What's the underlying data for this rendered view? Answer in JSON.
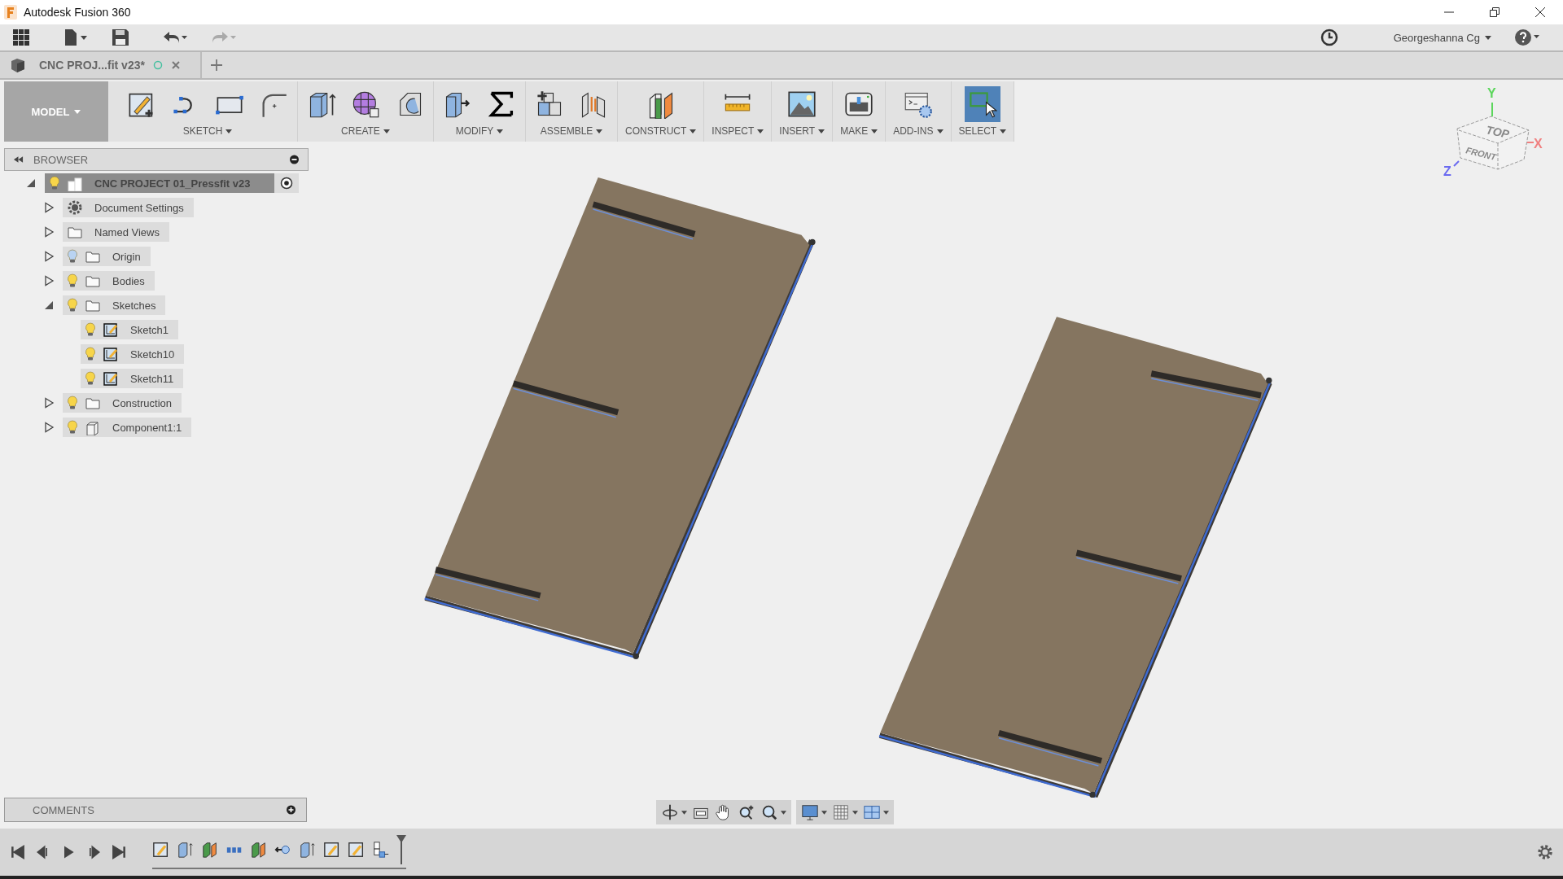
{
  "window": {
    "title": "Autodesk Fusion 360"
  },
  "account": {
    "user": "Georgeshanna Cg"
  },
  "document_tab": {
    "title": "CNC PROJ...fit v23*"
  },
  "ribbon": {
    "workspace": "MODEL",
    "groups": [
      {
        "label": "SKETCH",
        "active": false
      },
      {
        "label": "CREATE",
        "active": false
      },
      {
        "label": "MODIFY",
        "active": false
      },
      {
        "label": "ASSEMBLE",
        "active": false
      },
      {
        "label": "CONSTRUCT",
        "active": false
      },
      {
        "label": "INSPECT",
        "active": false
      },
      {
        "label": "INSERT",
        "active": false
      },
      {
        "label": "MAKE",
        "active": false
      },
      {
        "label": "ADD-INS",
        "active": false
      },
      {
        "label": "SELECT",
        "active": true
      }
    ]
  },
  "browser": {
    "title": "BROWSER",
    "tree": [
      {
        "label": "CNC PROJECT 01_Pressfit v23",
        "kind": "root",
        "visible": true,
        "selected": true,
        "expanded": true,
        "children": [
          {
            "label": "Document Settings",
            "kind": "settings",
            "selected": false,
            "expanded": false
          },
          {
            "label": "Named Views",
            "kind": "folder",
            "selected": false,
            "expanded": false
          },
          {
            "label": "Origin",
            "kind": "folder",
            "visible": false,
            "selected": false,
            "expanded": false
          },
          {
            "label": "Bodies",
            "kind": "folder",
            "visible": true,
            "selected": false,
            "expanded": false
          },
          {
            "label": "Sketches",
            "kind": "folder",
            "visible": true,
            "selected": false,
            "expanded": true,
            "children": [
              {
                "label": "Sketch1",
                "kind": "sketch",
                "visible": true,
                "selected": false
              },
              {
                "label": "Sketch10",
                "kind": "sketch",
                "visible": true,
                "selected": false
              },
              {
                "label": "Sketch11",
                "kind": "sketch",
                "visible": true,
                "selected": false
              }
            ]
          },
          {
            "label": "Construction",
            "kind": "folder",
            "visible": true,
            "selected": false,
            "expanded": false
          },
          {
            "label": "Component1:1",
            "kind": "component",
            "visible": true,
            "selected": false,
            "expanded": false
          }
        ]
      }
    ]
  },
  "view_cube": {
    "faces": [
      "TOP",
      "FRONT"
    ],
    "axes": [
      "Y",
      "X",
      "Z"
    ]
  },
  "comments": {
    "title": "COMMENTS"
  }
}
